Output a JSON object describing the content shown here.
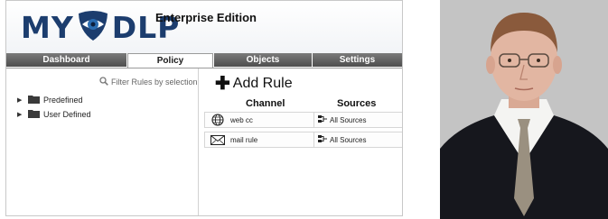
{
  "app": {
    "logo_text_left": "MY",
    "logo_text_right": "DLP",
    "edition": "Enterprise Edition"
  },
  "tabs": [
    {
      "label": "Dashboard",
      "active": false
    },
    {
      "label": "Policy",
      "active": true
    },
    {
      "label": "Objects",
      "active": false
    },
    {
      "label": "Settings",
      "active": false
    }
  ],
  "left_panel": {
    "filter_label": "Filter Rules by selection",
    "tree": [
      {
        "label": "Predefined"
      },
      {
        "label": "User Defined"
      }
    ]
  },
  "rules_panel": {
    "add_rule_label": "Add Rule",
    "columns": {
      "channel": "Channel",
      "sources": "Sources"
    },
    "rules": [
      {
        "icon": "globe-icon",
        "name": "web cc",
        "sources": "All Sources"
      },
      {
        "icon": "mail-icon",
        "name": "mail rule",
        "sources": "All Sources"
      }
    ]
  },
  "colors": {
    "brand_navy": "#1c3d6e",
    "brand_blue": "#2b6cb0",
    "tab_dark": "#5a5a5a"
  },
  "photo": {
    "icon": "person-portrait"
  }
}
